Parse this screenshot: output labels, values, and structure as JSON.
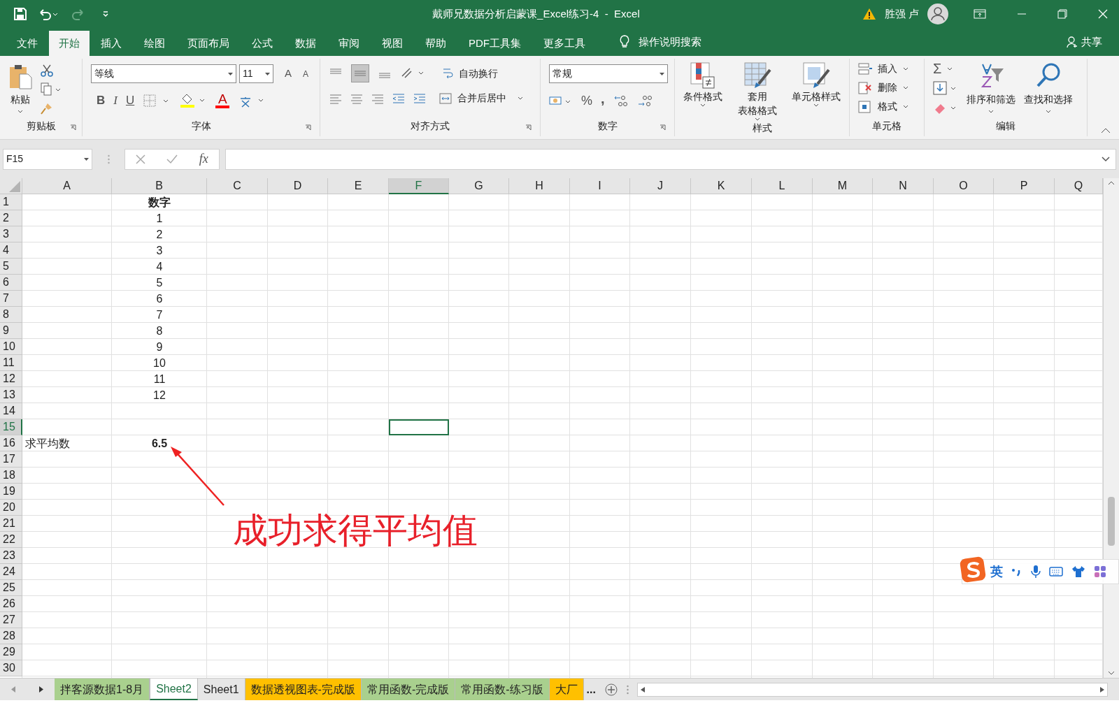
{
  "title_bar": {
    "title": "戴师兄数据分析启蒙课_Excel练习-4  -  Excel",
    "user": "胜强 卢"
  },
  "ribbon_tabs": [
    {
      "label": "文件",
      "selected": false
    },
    {
      "label": "开始",
      "selected": true
    },
    {
      "label": "插入",
      "selected": false
    },
    {
      "label": "绘图",
      "selected": false
    },
    {
      "label": "页面布局",
      "selected": false
    },
    {
      "label": "公式",
      "selected": false
    },
    {
      "label": "数据",
      "selected": false
    },
    {
      "label": "审阅",
      "selected": false
    },
    {
      "label": "视图",
      "selected": false
    },
    {
      "label": "帮助",
      "selected": false
    },
    {
      "label": "PDF工具集",
      "selected": false
    },
    {
      "label": "更多工具",
      "selected": false
    }
  ],
  "tell_me": "操作说明搜索",
  "share": "共享",
  "groups": {
    "clipboard": {
      "label": "剪贴板",
      "paste": "粘贴"
    },
    "font": {
      "label": "字体",
      "font_name": "等线",
      "font_size": "11",
      "grow_shrink": [
        "A",
        "A"
      ],
      "style_buttons": [
        "B",
        "I",
        "U"
      ],
      "font_color": "A"
    },
    "alignment": {
      "label": "对齐方式",
      "wrap_text": "自动换行",
      "merge": "合并后居中"
    },
    "number": {
      "label": "数字",
      "format": "常规",
      "percent": "%",
      "comma": ","
    },
    "styles": {
      "label": "样式",
      "buttons": [
        [
          "条件格式"
        ],
        [
          "套用",
          "表格格式"
        ],
        [
          "单元格样式"
        ]
      ]
    },
    "cells": {
      "label": "单元格",
      "buttons": [
        "插入",
        "删除",
        "格式"
      ]
    },
    "editing": {
      "label": "编辑",
      "sum": "Σ",
      "buttons": [
        "排序和筛选",
        "查找和选择"
      ]
    }
  },
  "formula_bar": {
    "name_box": "F15",
    "fx": "fx"
  },
  "sheet": {
    "columns": [
      {
        "label": "A",
        "selected": false
      },
      {
        "label": "B",
        "selected": false
      },
      {
        "label": "C",
        "selected": false
      },
      {
        "label": "D",
        "selected": false
      },
      {
        "label": "E",
        "selected": false
      },
      {
        "label": "F",
        "selected": true
      },
      {
        "label": "G",
        "selected": false
      },
      {
        "label": "H",
        "selected": false
      },
      {
        "label": "I",
        "selected": false
      },
      {
        "label": "J",
        "selected": false
      },
      {
        "label": "K",
        "selected": false
      },
      {
        "label": "L",
        "selected": false
      },
      {
        "label": "M",
        "selected": false
      },
      {
        "label": "N",
        "selected": false
      },
      {
        "label": "O",
        "selected": false
      },
      {
        "label": "P",
        "selected": false
      },
      {
        "label": "Q",
        "selected": false
      }
    ],
    "rows": [
      {
        "label": "1",
        "selected": false,
        "b": "数字",
        "bold": true
      },
      {
        "label": "2",
        "selected": false,
        "b": "1"
      },
      {
        "label": "3",
        "selected": false,
        "b": "2"
      },
      {
        "label": "4",
        "selected": false,
        "b": "3"
      },
      {
        "label": "5",
        "selected": false,
        "b": "4"
      },
      {
        "label": "6",
        "selected": false,
        "b": "5"
      },
      {
        "label": "7",
        "selected": false,
        "b": "6"
      },
      {
        "label": "8",
        "selected": false,
        "b": "7"
      },
      {
        "label": "9",
        "selected": false,
        "b": "8"
      },
      {
        "label": "10",
        "selected": false,
        "b": "9"
      },
      {
        "label": "11",
        "selected": false,
        "b": "10"
      },
      {
        "label": "12",
        "selected": false,
        "b": "11"
      },
      {
        "label": "13",
        "selected": false,
        "b": "12"
      },
      {
        "label": "14",
        "selected": false
      },
      {
        "label": "15",
        "selected": true
      },
      {
        "label": "16",
        "selected": false,
        "a": "求平均数",
        "b": "6.5",
        "bold": true
      },
      {
        "label": "17",
        "selected": false
      },
      {
        "label": "18",
        "selected": false
      },
      {
        "label": "19",
        "selected": false
      },
      {
        "label": "20",
        "selected": false
      },
      {
        "label": "21",
        "selected": false
      },
      {
        "label": "22",
        "selected": false
      },
      {
        "label": "23",
        "selected": false
      },
      {
        "label": "24",
        "selected": false
      },
      {
        "label": "25",
        "selected": false
      },
      {
        "label": "26",
        "selected": false
      },
      {
        "label": "27",
        "selected": false
      },
      {
        "label": "28",
        "selected": false
      },
      {
        "label": "29",
        "selected": false
      },
      {
        "label": "30",
        "selected": false
      }
    ]
  },
  "annotation": {
    "text": "成功求得平均值"
  },
  "ime_toolbar": {
    "mode": "英"
  },
  "sheet_tabs": [
    {
      "label": "拌客源数据1-8月",
      "color": "#a9d08e",
      "selected": false
    },
    {
      "label": "Sheet2",
      "color": "#ffffff",
      "selected": true
    },
    {
      "label": "Sheet1",
      "color": "#e6e6e6",
      "selected": false
    },
    {
      "label": "数据透视图表-完成版",
      "color": "#ffc000",
      "selected": false
    },
    {
      "label": "常用函数-完成版",
      "color": "#a9d08e",
      "selected": false
    },
    {
      "label": "常用函数-练习版",
      "color": "#a9d08e",
      "selected": false
    },
    {
      "label": "大厂",
      "color": "#ffc000",
      "selected": false
    }
  ],
  "more_tabs": "..."
}
